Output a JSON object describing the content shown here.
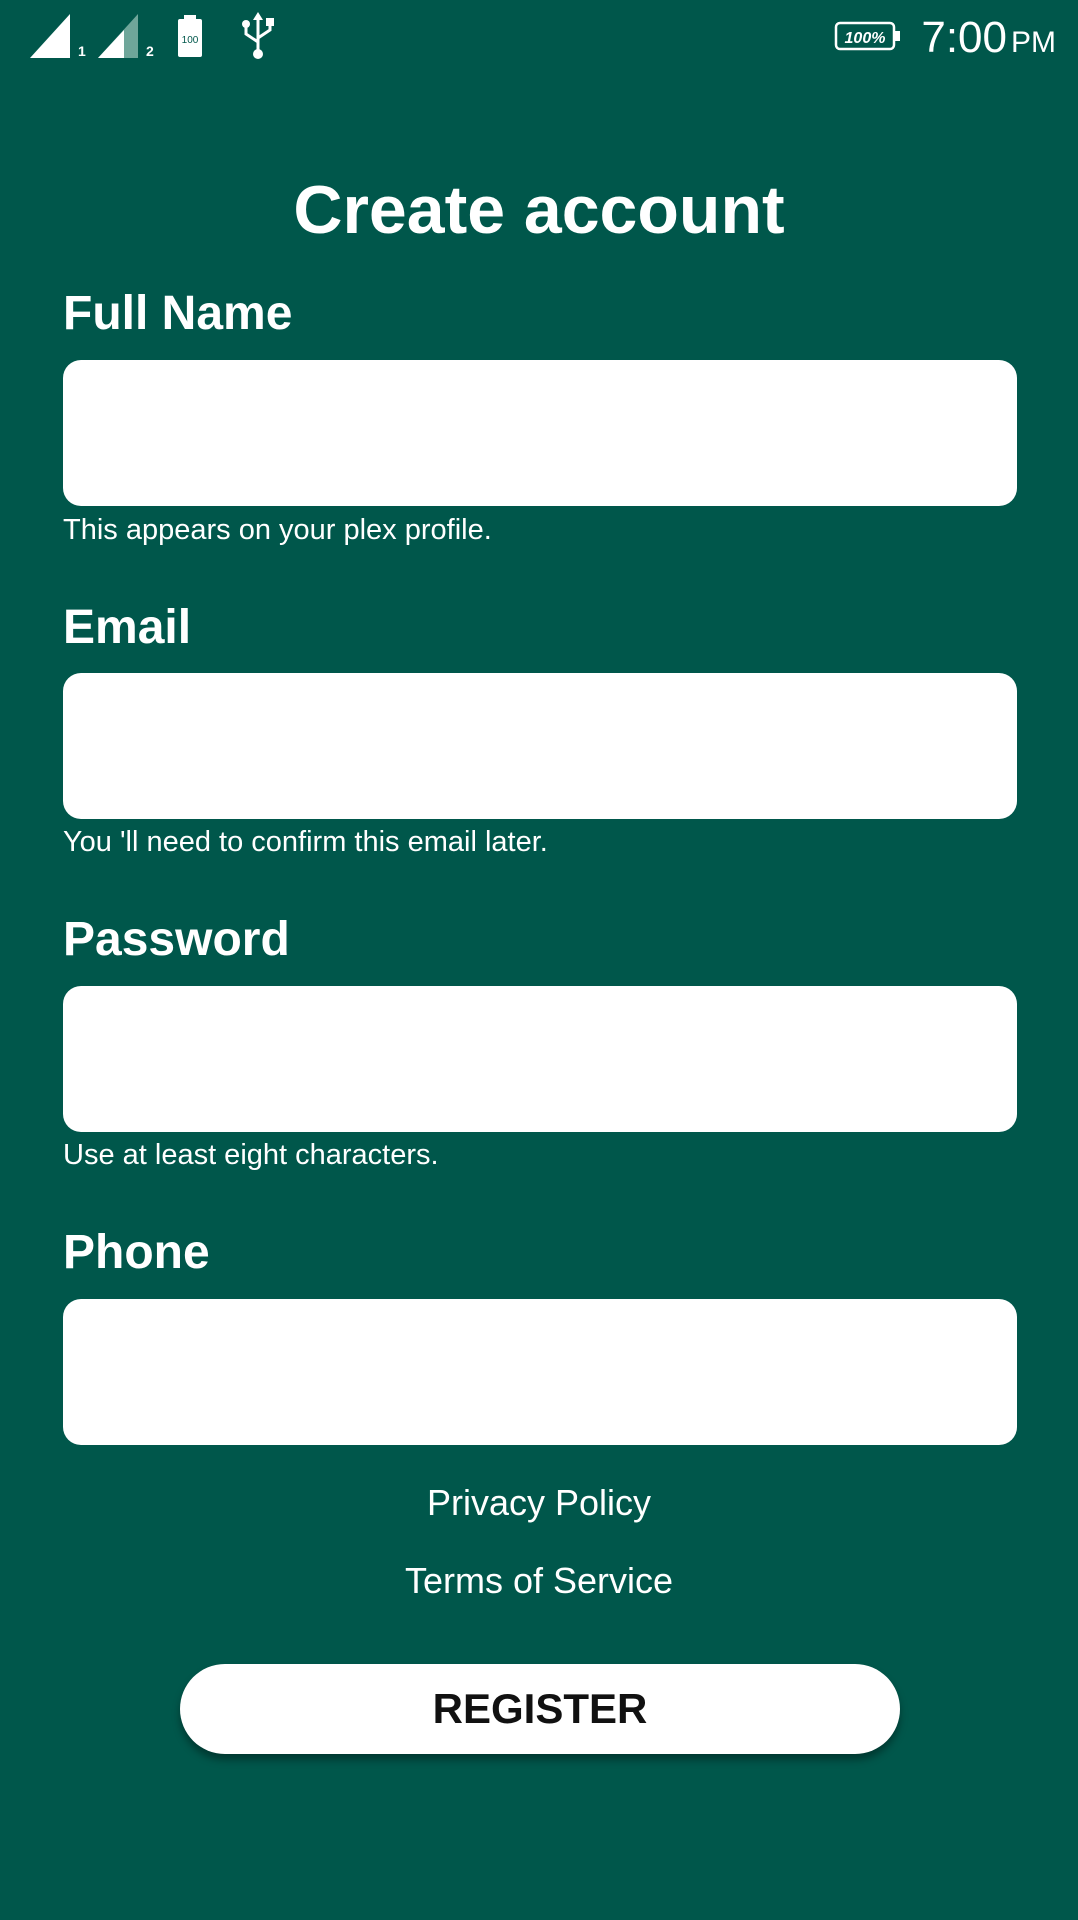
{
  "status_bar": {
    "sim1_label": "1",
    "sim2_label": "2",
    "battery_small_label": "100",
    "battery_percent": "100%",
    "time": "7:00",
    "ampm": "PM",
    "icons": [
      "signal-sim1-icon",
      "signal-sim2-icon",
      "battery-icon",
      "usb-icon",
      "battery-percent-icon"
    ]
  },
  "form": {
    "title": "Create account",
    "fields": [
      {
        "label": "Full Name",
        "value": "",
        "hint": "This appears on your plex profile."
      },
      {
        "label": "Email",
        "value": "",
        "hint": "You 'll need to confirm this email later."
      },
      {
        "label": "Password",
        "value": "",
        "hint": "Use at least eight characters."
      },
      {
        "label": "Phone",
        "value": ""
      }
    ],
    "privacy_link": "Privacy Policy",
    "terms_link": "Terms of Service",
    "register_label": "REGISTER"
  },
  "colors": {
    "background": "#00574b",
    "input_background": "#ffffff",
    "button_background": "#ffffff",
    "button_text": "#111111"
  }
}
